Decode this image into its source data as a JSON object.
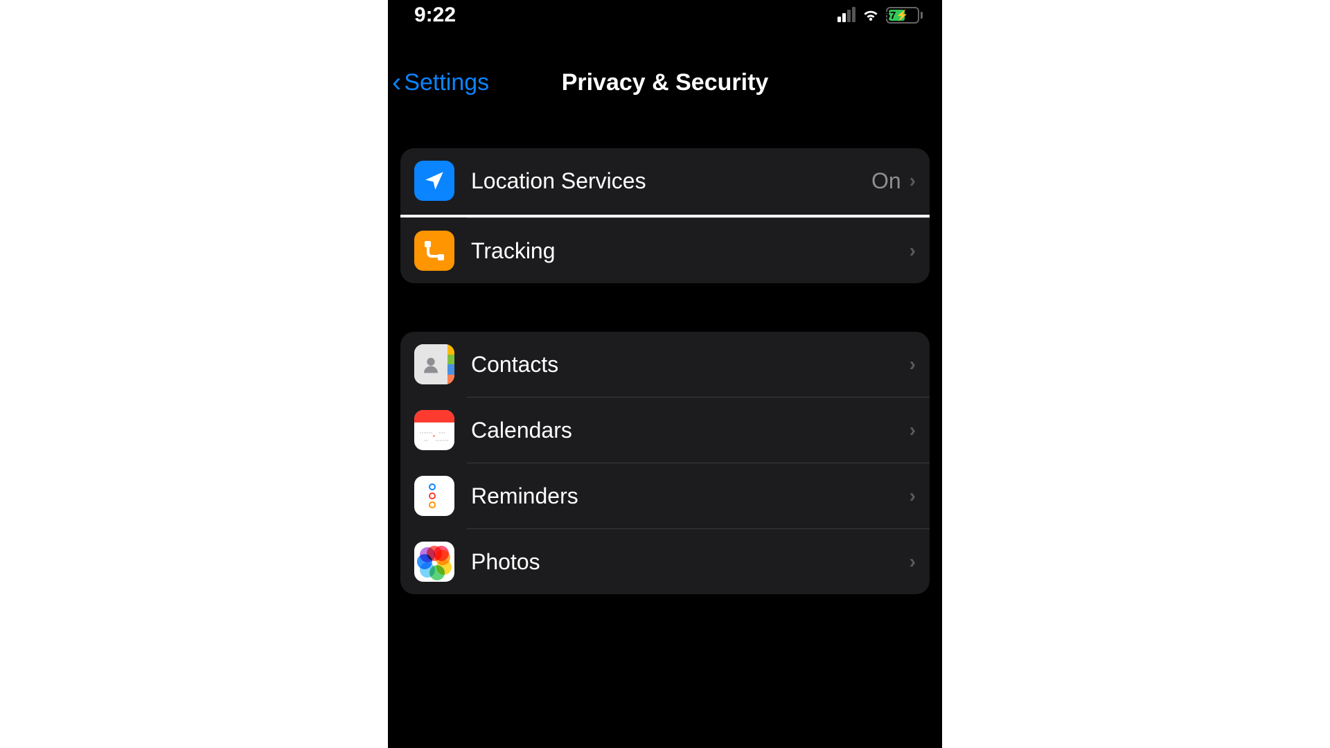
{
  "status_bar": {
    "time": "9:22",
    "battery_percent": "57"
  },
  "nav": {
    "back_label": "Settings",
    "title": "Privacy & Security"
  },
  "group1": {
    "location_services": {
      "label": "Location Services",
      "value": "On"
    },
    "tracking": {
      "label": "Tracking"
    }
  },
  "group2": {
    "contacts": {
      "label": "Contacts"
    },
    "calendars": {
      "label": "Calendars"
    },
    "reminders": {
      "label": "Reminders"
    },
    "photos": {
      "label": "Photos"
    }
  }
}
